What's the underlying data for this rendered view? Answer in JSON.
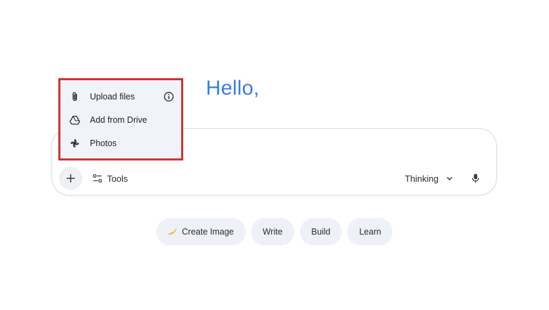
{
  "greeting": "Hello,",
  "attach_menu": {
    "items": [
      {
        "label": "Upload files",
        "icon": "paperclip-icon",
        "has_info": true
      },
      {
        "label": "Add from Drive",
        "icon": "drive-icon"
      },
      {
        "label": "Photos",
        "icon": "pinwheel-icon"
      }
    ]
  },
  "composer": {
    "plus_icon": "plus-icon",
    "tools_label": "Tools",
    "mode_label": "Thinking",
    "mic_icon": "mic-icon"
  },
  "chips": [
    {
      "label": "Create Image",
      "icon": "banana-icon"
    },
    {
      "label": "Write"
    },
    {
      "label": "Build"
    },
    {
      "label": "Learn"
    }
  ],
  "colors": {
    "greeting": "#3b7ddd",
    "highlight_border": "#d32f2f",
    "chip_bg": "#eef1f5",
    "menu_bg": "#f0f3f8"
  }
}
